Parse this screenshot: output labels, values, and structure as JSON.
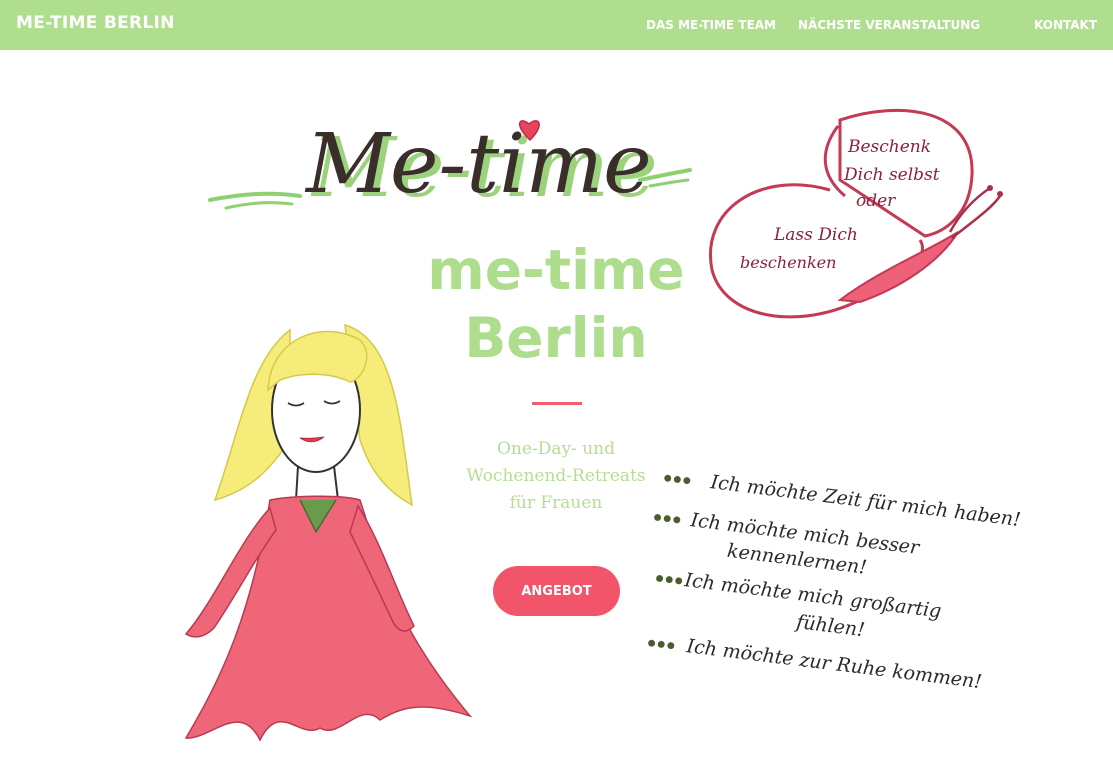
{
  "nav": {
    "brand": "ME-TIME BERLIN",
    "links": [
      "DAS ME-TIME TEAM",
      "NÄCHSTE VERANSTALTUNG",
      "KONTAKT"
    ]
  },
  "hero": {
    "logo_text": "Me-time",
    "title_line1": "me-time",
    "title_line2": "Berlin",
    "tagline_lines": [
      "One-Day- und",
      "Wochenend-Retreats",
      "für Frauen"
    ],
    "cta_label": "ANGEBOT"
  },
  "butterfly": {
    "lines": [
      "Beschenk",
      "Dich selbst",
      "oder",
      "Lass Dich",
      "beschenken"
    ]
  },
  "wishes": [
    "Ich möchte Zeit für mich haben!",
    "Ich möchte mich besser",
    "kennenlernen!",
    "Ich möchte mich großartig",
    "fühlen!",
    "Ich möchte zur Ruhe kommen!"
  ],
  "colors": {
    "navbar": "#b0de8f",
    "accent": "#f2556a",
    "title_green": "#aedd8e"
  }
}
